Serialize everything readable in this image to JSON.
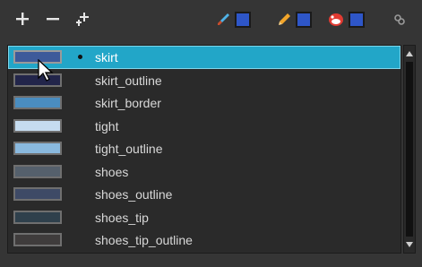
{
  "toolbar": {
    "add_icon": "plus-icon",
    "remove_icon": "minus-icon",
    "clone_icon": "clone-plus-icon",
    "brush_icon": "brush-icon",
    "pencil_icon": "pencil-icon",
    "paint_icon": "paint-bucket-icon",
    "link_icon": "link-icon",
    "swatch_color": "#2e56c8"
  },
  "palette": {
    "selected_index": 0,
    "items": [
      {
        "label": "skirt",
        "color": "#3d5a9a"
      },
      {
        "label": "skirt_outline",
        "color": "#22254a"
      },
      {
        "label": "skirt_border",
        "color": "#4a8dc0"
      },
      {
        "label": "tight",
        "color": "#c6dcf0"
      },
      {
        "label": "tight_outline",
        "color": "#8ab9de"
      },
      {
        "label": "shoes",
        "color": "#55606c"
      },
      {
        "label": "shoes_outline",
        "color": "#3e4a66"
      },
      {
        "label": "shoes_tip",
        "color": "#2f404c"
      },
      {
        "label": "shoes_tip_outline",
        "color": "#3f3c3c"
      }
    ]
  },
  "colors": {
    "selection": "#22a6c8",
    "panel_bg": "#353535",
    "list_bg": "#2a2a2a"
  }
}
